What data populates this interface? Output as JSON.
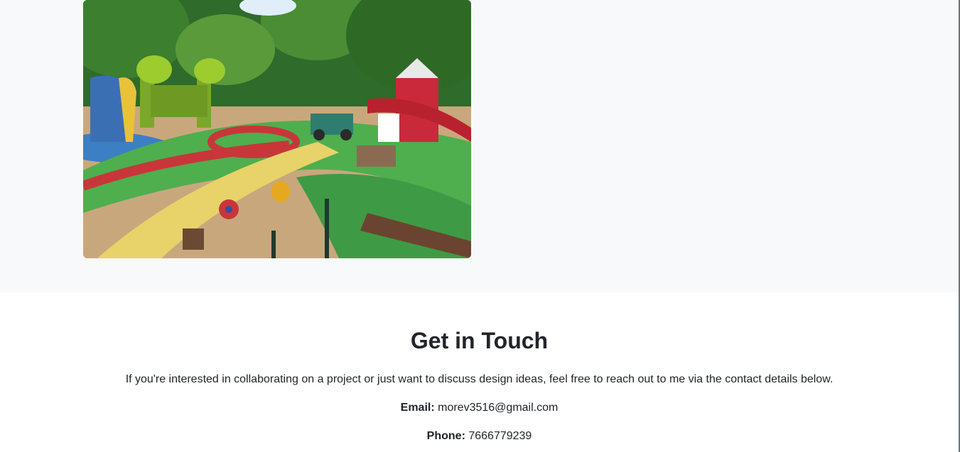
{
  "portfolio": {
    "image_alt": "Colorful children's playground with farm-themed play structures"
  },
  "contact": {
    "title": "Get in Touch",
    "intro": "If you're interested in collaborating on a project or just want to discuss design ideas, feel free to reach out to me via the contact details below.",
    "email_label": "Email:",
    "email_value": "morev3516@gmail.com",
    "phone_label": "Phone:",
    "phone_value": "7666779239"
  },
  "colors": {
    "section_bg": "#f8f9fa",
    "text": "#212529",
    "page_bg": "#ffffff"
  }
}
